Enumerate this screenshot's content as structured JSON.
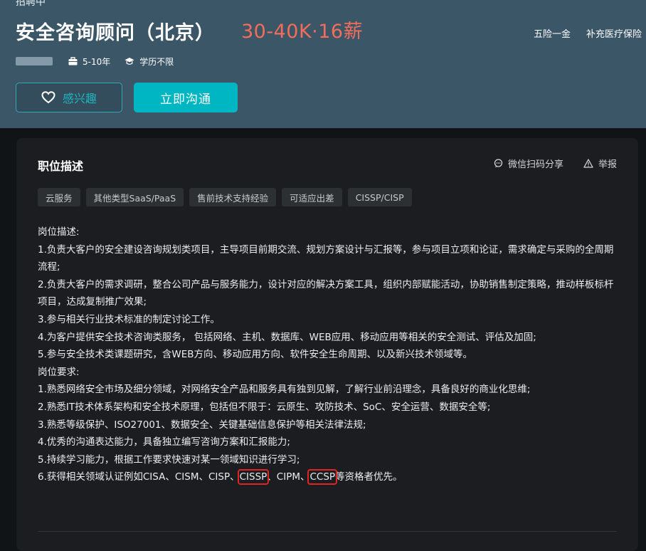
{
  "header": {
    "breadcrumb": "招聘中",
    "title": "安全咨询顾问（北京）",
    "salary": "30-40K·16薪",
    "benefits": [
      "五险一金",
      "补充医疗保险"
    ],
    "experience": "5-10年",
    "education": "学历不限",
    "interest_label": "感兴趣",
    "chat_label": "立即沟通"
  },
  "card": {
    "title": "职位描述",
    "share_label": "微信扫码分享",
    "report_label": "举报",
    "tags": [
      "云服务",
      "其他类型SaaS/PaaS",
      "售前技术支持经验",
      "可适应出差",
      "CISSP/CISP"
    ]
  },
  "description": {
    "heading1": "岗位描述:",
    "duties": [
      "1.负责大客户的安全建设咨询规划类项目，主导项目前期交流、规划方案设计与汇报等，参与项目立项和论证，需求确定与采购的全周期流程;",
      "2.负责大客户的需求调研，整合公司产品与服务能力，设计对应的解决方案工具，组织内部赋能活动，协助销售制定策略，推动样板标杆项目，达成复制推广效果;",
      "3.参与相关行业技术标准的制定讨论工作。",
      "4.为客户提供安全技术咨询类服务， 包括网络、主机、数据库、WEB应用、移动应用等相关的安全测试、评估及加固;",
      "5.参与安全技术类课题研究，含WEB方向、移动应用方向、软件安全生命周期、以及新兴技术领域等。"
    ],
    "heading2": "岗位要求:",
    "requirements": [
      "1.熟悉网络安全市场及细分领域，对网络安全产品和服务具有独到见解，了解行业前沿理念，具备良好的商业化思维;",
      "2.熟悉IT技术体系架构和安全技术原理，包括但不限于：云原生、攻防技术、SoC、安全运营、数据安全等;",
      "3.熟悉等级保护、ISO27001、数据安全、关键基础信息保护等相关法律法规;",
      "4.优秀的沟通表达能力，具备独立编写咨询方案和汇报能力;",
      "5.持续学习能力，根据工作要求快速对某一领域知识进行学习;"
    ],
    "req6": {
      "part1": "6.获得相关领域认证例如CISA、CISM、CISP、",
      "hl1": "CISSP",
      "part2": "、CIPM、",
      "hl2": "CCSP",
      "part3": "等资格者优先。"
    }
  },
  "colors": {
    "header_bg": "#3b5667",
    "salary": "#f26d5b",
    "accent": "#00b6c2",
    "highlight_box": "#e02424"
  }
}
